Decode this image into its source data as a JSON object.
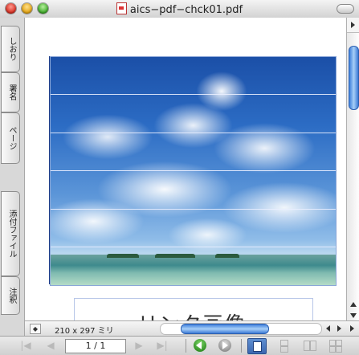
{
  "window": {
    "title": "aics−pdf−chck01.pdf"
  },
  "drawer_tabs": [
    {
      "label": "しおり"
    },
    {
      "label": "署名"
    },
    {
      "label": "ページ"
    },
    {
      "label": "添付ファイル"
    },
    {
      "label": "注釈"
    }
  ],
  "document": {
    "link_text": "リンク画像"
  },
  "status": {
    "page_size": "210 x 297 ミリ"
  },
  "toolbar": {
    "page_value": "1 / 1"
  },
  "colors": {
    "accent": "#3b7ad6",
    "frame_border": "#8aa6d8"
  }
}
